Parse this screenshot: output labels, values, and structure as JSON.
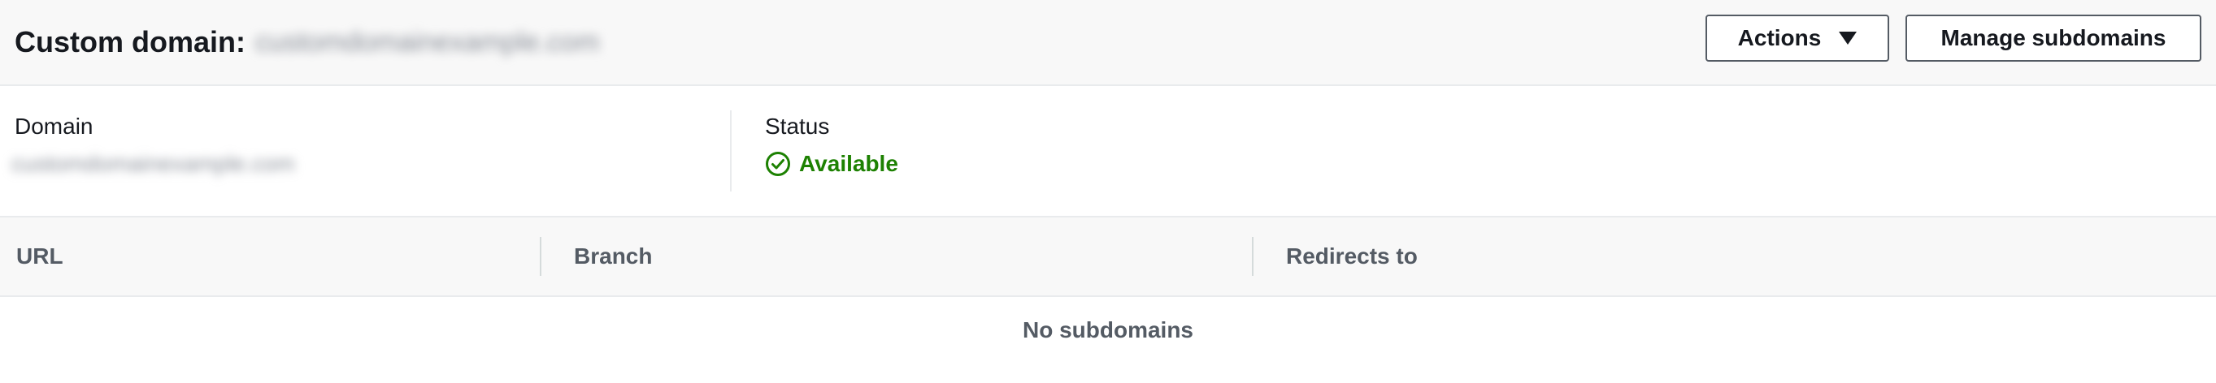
{
  "header": {
    "title": "Custom domain:",
    "domain_blurred": "customdomainexample.com",
    "actions_label": "Actions",
    "manage_label": "Manage subdomains"
  },
  "details": {
    "domain_label": "Domain",
    "domain_value_blurred": "customdomainexample.com",
    "status_label": "Status",
    "status_value": "Available",
    "status_icon": "check-circle-icon",
    "status_color": "#1d8102"
  },
  "table": {
    "columns": [
      "URL",
      "Branch",
      "Redirects to"
    ],
    "empty_message": "No subdomains"
  }
}
